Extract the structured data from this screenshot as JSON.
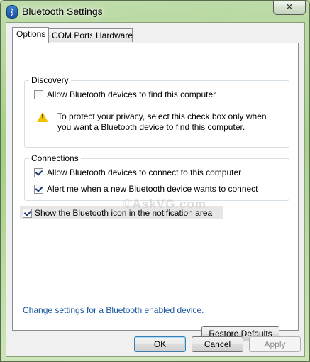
{
  "window": {
    "title": "Bluetooth Settings",
    "close_glyph": "✕",
    "app_icon": "bluetooth-icon"
  },
  "tabs": [
    {
      "label": "Options",
      "active": true
    },
    {
      "label": "COM Ports",
      "active": false
    },
    {
      "label": "Hardware",
      "active": false
    }
  ],
  "discovery": {
    "legend": "Discovery",
    "allow_find": {
      "label": "Allow Bluetooth devices to find this computer",
      "checked": false
    },
    "warning_icon": "warning-icon",
    "warning_line1": "To protect your privacy, select this check box only when",
    "warning_line2": "you want a Bluetooth device to find this computer."
  },
  "connections": {
    "legend": "Connections",
    "allow_connect": {
      "label": "Allow Bluetooth devices to connect to this computer",
      "checked": true
    },
    "alert_me": {
      "label": "Alert me when a new Bluetooth device wants to connect",
      "checked": true
    }
  },
  "show_icon": {
    "label": "Show the Bluetooth icon in the notification area",
    "checked": true
  },
  "watermark": "©AskVG.com",
  "change_link": "Change settings for a Bluetooth enabled device.",
  "buttons": {
    "restore": "Restore Defaults",
    "ok": "OK",
    "cancel": "Cancel",
    "apply": "Apply"
  },
  "colors": {
    "link": "#1a56a0",
    "warning": "#f2c200",
    "check": "#1f3d7a"
  }
}
